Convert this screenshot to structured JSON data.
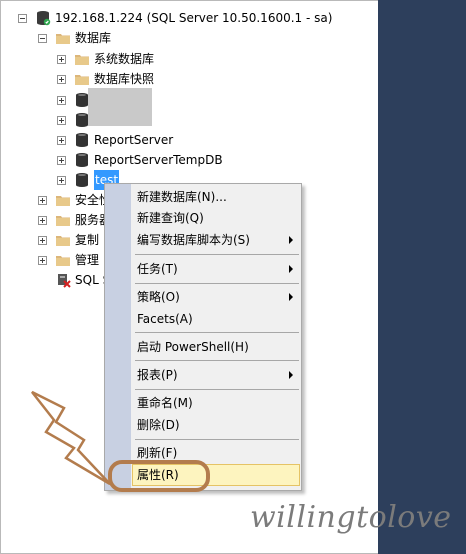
{
  "tree": {
    "server": "192.168.1.224 (SQL Server 10.50.1600.1 - sa)",
    "databases_folder": "数据库",
    "system_databases": "系统数据库",
    "database_snapshots": "数据库快照",
    "report_server": "ReportServer",
    "report_server_temp": "ReportServerTempDB",
    "test_db": "test",
    "security": "安全性",
    "server_objects": "服务器",
    "replication": "复制",
    "management": "管理",
    "sql_agent": "SQL S"
  },
  "context_menu": {
    "new_database": "新建数据库(N)...",
    "new_query": "新建查询(Q)",
    "script_database_as": "编写数据库脚本为(S)",
    "tasks": "任务(T)",
    "policies": "策略(O)",
    "facets": "Facets(A)",
    "start_powershell": "启动 PowerShell(H)",
    "reports": "报表(P)",
    "rename": "重命名(M)",
    "delete": "删除(D)",
    "refresh": "刷新(F)",
    "properties": "属性(R)"
  },
  "watermark": "willingtolove",
  "colors": {
    "selection": "#3399ff",
    "menu_highlight": "#fdf4bf",
    "annotation": "#b37c4d",
    "right_panel": "#2d3f5c"
  }
}
